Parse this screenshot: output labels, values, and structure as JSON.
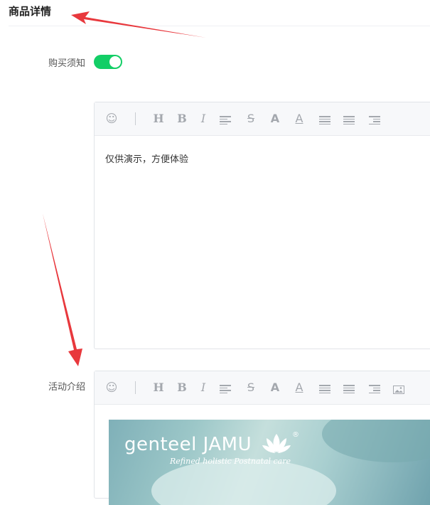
{
  "section": {
    "title": "商品详情"
  },
  "purchase_notice": {
    "label": "购买须知",
    "enabled": true
  },
  "activity_intro": {
    "label": "活动介绍"
  },
  "editor1": {
    "content": "仅供演示，方便体验",
    "toolbar": [
      "emoji-icon",
      "heading-icon",
      "bold-icon",
      "italic-icon",
      "align-icon",
      "strikethrough-icon",
      "font-size-icon",
      "font-color-icon",
      "ordered-list-icon",
      "unordered-list-icon",
      "indent-icon"
    ]
  },
  "editor2": {
    "toolbar": [
      "emoji-icon",
      "heading-icon",
      "bold-icon",
      "italic-icon",
      "align-icon",
      "strikethrough-icon",
      "font-size-icon",
      "font-color-icon",
      "ordered-list-icon",
      "unordered-list-icon",
      "indent-icon",
      "image-icon"
    ],
    "image": {
      "brand": "genteel JAMU",
      "tagline": "Refined holistic Postnatal care",
      "mark": "®"
    }
  },
  "colors": {
    "switch_on": "#13ce66",
    "annotation_arrow": "#e8383d"
  }
}
